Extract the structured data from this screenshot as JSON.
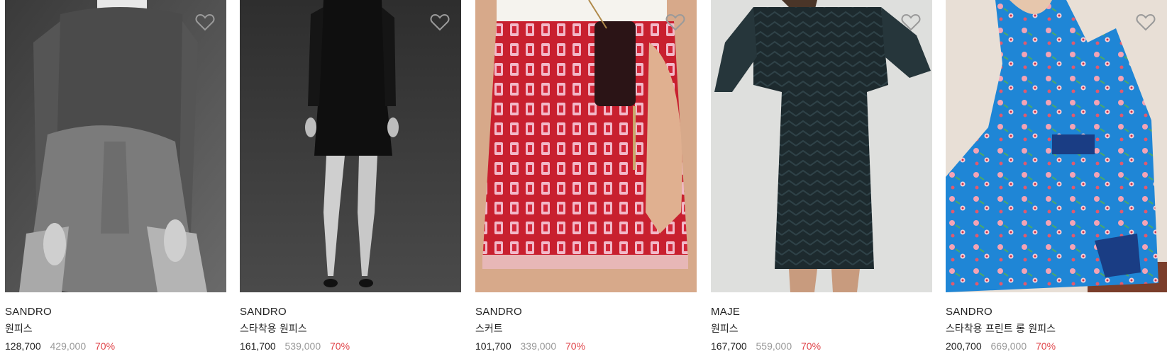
{
  "products": [
    {
      "brand": "SANDRO",
      "name": "원피스",
      "price": "128,700",
      "original_price": "429,000",
      "discount": "70%",
      "image": "grey-knit-dress-photo",
      "wishlist_icon": "heart-icon"
    },
    {
      "brand": "SANDRO",
      "name": "스타착용 원피스",
      "price": "161,700",
      "original_price": "539,000",
      "discount": "70%",
      "image": "black-mini-dress-photo",
      "wishlist_icon": "heart-icon"
    },
    {
      "brand": "SANDRO",
      "name": "스커트",
      "price": "101,700",
      "original_price": "339,000",
      "discount": "70%",
      "image": "red-lace-skirt-photo",
      "wishlist_icon": "heart-icon"
    },
    {
      "brand": "MAJE",
      "name": "원피스",
      "price": "167,700",
      "original_price": "559,000",
      "discount": "70%",
      "image": "navy-lace-dress-photo",
      "wishlist_icon": "heart-icon"
    },
    {
      "brand": "SANDRO",
      "name": "스타착용 프린트 롱 원피스",
      "price": "200,700",
      "original_price": "669,000",
      "discount": "70%",
      "image": "blue-floral-dress-photo",
      "wishlist_icon": "heart-icon"
    }
  ],
  "colors": {
    "price": "#222222",
    "original_price": "#9a9a9a",
    "discount": "#e0464b"
  }
}
